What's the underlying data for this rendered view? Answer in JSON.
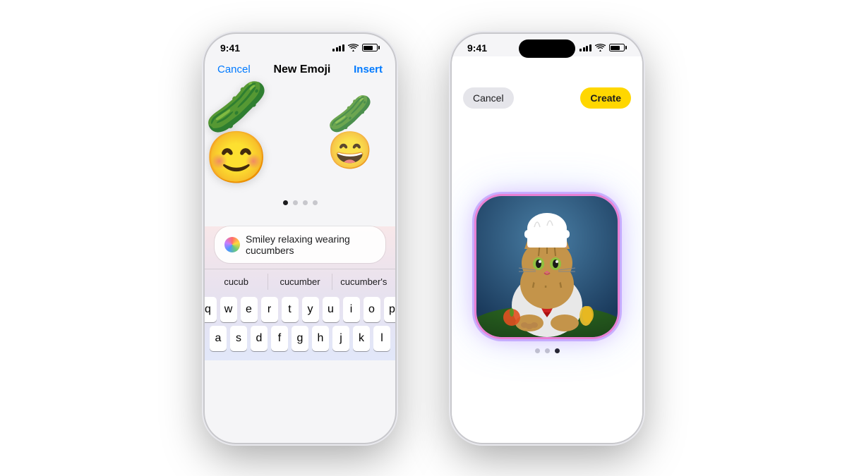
{
  "phone1": {
    "status_time": "9:41",
    "nav": {
      "cancel": "Cancel",
      "title": "New Emoji",
      "insert": "Insert"
    },
    "emoji_main": "🥒😊",
    "emoji_secondary": "🥒😁",
    "search_text": "Smiley relaxing wearing cucumbers",
    "autocomplete": [
      "cucub",
      "cucumber",
      "cucumber's"
    ],
    "keyboard_rows": [
      [
        "q",
        "w",
        "e",
        "r",
        "t",
        "y",
        "u",
        "i",
        "o",
        "p"
      ],
      [
        "a",
        "s",
        "d",
        "f",
        "g",
        "h",
        "j",
        "k",
        "l"
      ]
    ]
  },
  "phone2": {
    "status_time": "9:41",
    "nav": {
      "cancel": "Cancel",
      "create": "Create"
    },
    "page_dots_count": 3,
    "page_dots_active": 2
  },
  "colors": {
    "ios_blue": "#007AFF",
    "yellow_create": "#FFD700",
    "cancel_bg": "#e5e5ea"
  }
}
